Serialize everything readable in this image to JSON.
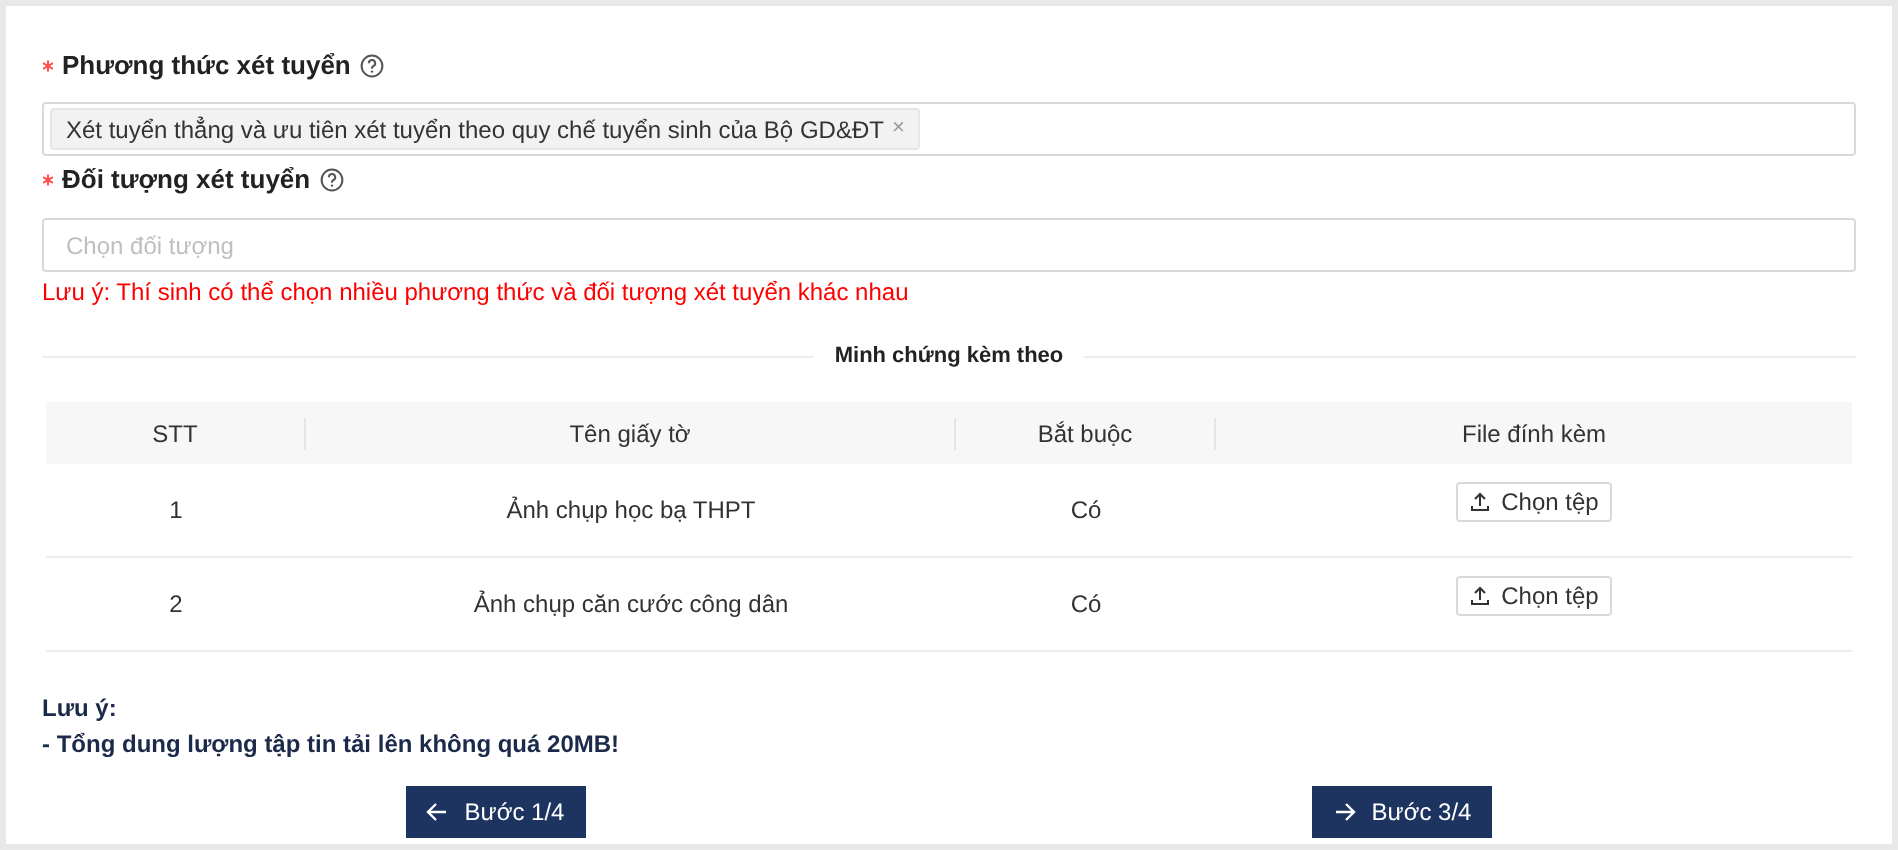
{
  "method_field": {
    "label": "Phương thức xét tuyển",
    "required": true,
    "tags": [
      "Xét tuyển thẳng và ưu tiên xét tuyển theo quy chế tuyển sinh của Bộ GD&ĐT"
    ],
    "tag_remove": "×"
  },
  "target_field": {
    "label": "Đối tượng xét tuyển",
    "required": true,
    "placeholder": "Chọn đối tượng"
  },
  "warning": "Lưu ý: Thí sinh có thể chọn nhiều phương thức và đối tượng xét tuyển khác nhau",
  "section_title": "Minh chứng kèm theo",
  "table": {
    "columns": [
      "STT",
      "Tên giấy tờ",
      "Bắt buộc",
      "File đính kèm"
    ],
    "rows": [
      {
        "index": "1",
        "name": "Ảnh chụp học bạ THPT",
        "required": "Có",
        "action": "Chọn tệp"
      },
      {
        "index": "2",
        "name": "Ảnh chụp căn cước công dân",
        "required": "Có",
        "action": "Chọn tệp"
      }
    ]
  },
  "notes": [
    "Lưu ý:",
    "- Tổng dung lượng tập tin tải lên không quá 20MB!"
  ],
  "buttons": [
    {
      "label": "Bước 1/4",
      "kind": "back"
    },
    {
      "label": "Bước 3/4",
      "kind": "next"
    }
  ]
}
